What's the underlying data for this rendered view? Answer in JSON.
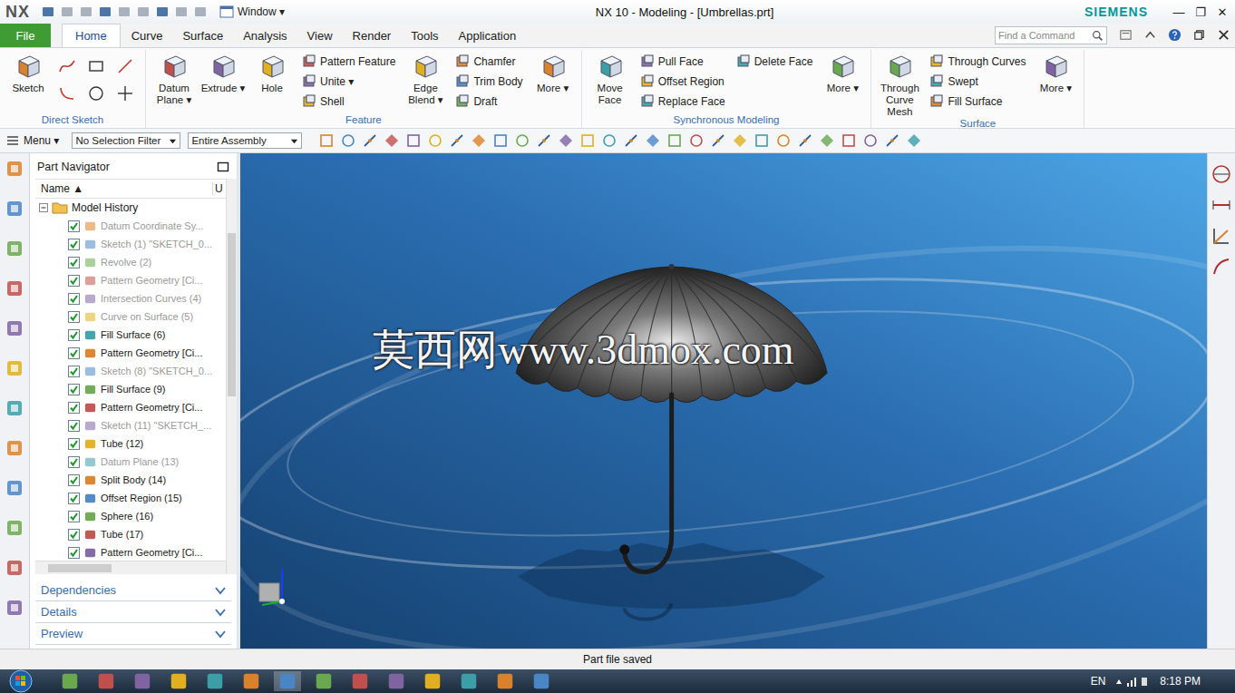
{
  "window": {
    "logo": "NX",
    "window_menu": "Window ▾",
    "title": "NX 10 - Modeling - [Umbrellas.prt]",
    "brand": "SIEMENS",
    "controls": [
      "—",
      "❐",
      "✕"
    ]
  },
  "ribbon_tabs": [
    {
      "label": "File",
      "selected": false,
      "kind": "file"
    },
    {
      "label": "Home",
      "selected": true,
      "kind": "tab"
    },
    {
      "label": "Curve",
      "selected": false,
      "kind": "tab"
    },
    {
      "label": "Surface",
      "selected": false,
      "kind": "tab"
    },
    {
      "label": "Analysis",
      "selected": false,
      "kind": "tab"
    },
    {
      "label": "View",
      "selected": false,
      "kind": "tab"
    },
    {
      "label": "Render",
      "selected": false,
      "kind": "tab"
    },
    {
      "label": "Tools",
      "selected": false,
      "kind": "tab"
    },
    {
      "label": "Application",
      "selected": false,
      "kind": "tab"
    }
  ],
  "command_search": {
    "placeholder": "Find a Command"
  },
  "ribbon_groups": [
    {
      "label": "Direct Sketch",
      "columns": [
        {
          "kind": "large",
          "items": [
            "Sketch"
          ]
        },
        {
          "kind": "sketch-tools",
          "items": []
        }
      ]
    },
    {
      "label": "Feature",
      "columns": [
        {
          "kind": "large",
          "items": [
            "Datum Plane ▾",
            "Extrude ▾",
            "Hole"
          ]
        },
        {
          "kind": "small",
          "items": [
            "Pattern Feature",
            "Unite ▾",
            "Shell"
          ]
        },
        {
          "kind": "large",
          "items": [
            "Edge Blend ▾"
          ]
        },
        {
          "kind": "small",
          "items": [
            "Chamfer",
            "Trim Body",
            "Draft"
          ]
        },
        {
          "kind": "large",
          "items": [
            "More ▾"
          ]
        }
      ]
    },
    {
      "label": "Synchronous Modeling",
      "columns": [
        {
          "kind": "large",
          "items": [
            "Move Face"
          ]
        },
        {
          "kind": "small",
          "items": [
            "Pull Face",
            "Offset Region",
            "Replace Face"
          ]
        },
        {
          "kind": "small",
          "items": [
            "Delete Face"
          ]
        },
        {
          "kind": "large",
          "items": [
            "More ▾"
          ]
        }
      ]
    },
    {
      "label": "Surface",
      "columns": [
        {
          "kind": "large",
          "items": [
            "Through Curve Mesh"
          ]
        },
        {
          "kind": "small",
          "items": [
            "Through Curves",
            "Swept",
            "Fill Surface"
          ]
        },
        {
          "kind": "large",
          "items": [
            "More ▾"
          ]
        }
      ]
    }
  ],
  "toolbar": {
    "menu": "Menu ▾",
    "selection_filter": "No Selection Filter",
    "scope": "Entire Assembly"
  },
  "navigator": {
    "title": "Part Navigator",
    "columns": [
      "Name ▲",
      "U"
    ],
    "root": {
      "label": "Model History",
      "expanded": true
    },
    "items": [
      {
        "label": "Datum Coordinate Sy...",
        "checked": true,
        "greyed": true
      },
      {
        "label": "Sketch (1) \"SKETCH_0...",
        "checked": true,
        "greyed": true
      },
      {
        "label": "Revolve (2)",
        "checked": true,
        "greyed": true
      },
      {
        "label": "Pattern Geometry [Ci...",
        "checked": true,
        "greyed": true
      },
      {
        "label": "Intersection Curves (4)",
        "checked": true,
        "greyed": true
      },
      {
        "label": "Curve on Surface (5)",
        "checked": true,
        "greyed": true
      },
      {
        "label": "Fill Surface (6)",
        "checked": true,
        "greyed": false
      },
      {
        "label": "Pattern Geometry [Ci...",
        "checked": true,
        "greyed": false
      },
      {
        "label": "Sketch (8) \"SKETCH_0...",
        "checked": true,
        "greyed": true
      },
      {
        "label": "Fill Surface (9)",
        "checked": true,
        "greyed": false
      },
      {
        "label": "Pattern Geometry [Ci...",
        "checked": true,
        "greyed": false
      },
      {
        "label": "Sketch (11) \"SKETCH_...",
        "checked": true,
        "greyed": true
      },
      {
        "label": "Tube (12)",
        "checked": true,
        "greyed": false
      },
      {
        "label": "Datum Plane (13)",
        "checked": true,
        "greyed": true
      },
      {
        "label": "Split Body (14)",
        "checked": true,
        "greyed": false
      },
      {
        "label": "Offset Region (15)",
        "checked": true,
        "greyed": false
      },
      {
        "label": "Sphere (16)",
        "checked": true,
        "greyed": false
      },
      {
        "label": "Tube (17)",
        "checked": true,
        "greyed": false
      },
      {
        "label": "Pattern Geometry [Ci...",
        "checked": true,
        "greyed": false
      }
    ],
    "sections": [
      {
        "label": "Dependencies",
        "expanded": false
      },
      {
        "label": "Details",
        "expanded": false
      },
      {
        "label": "Preview",
        "expanded": false
      }
    ]
  },
  "viewport": {
    "watermark": "莫西网www.3dmox.com"
  },
  "status_bar": {
    "message": "Part file saved"
  },
  "taskbar": {
    "language": "EN",
    "time": "8:18 PM"
  }
}
